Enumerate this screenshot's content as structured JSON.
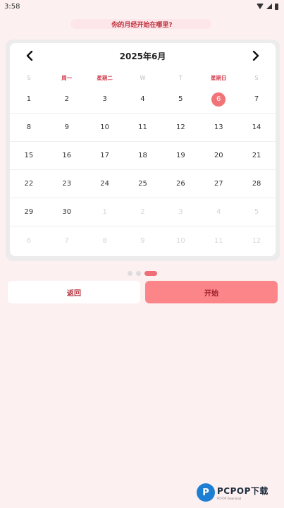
{
  "status_bar": {
    "time": "3:58"
  },
  "question": "你的月经开始在哪里?",
  "calendar": {
    "title": "2025年6月",
    "weekdays": [
      "S",
      "周一",
      "星期二",
      "W",
      "T",
      "星期日",
      "S"
    ],
    "weeks": [
      [
        {
          "d": "1"
        },
        {
          "d": "2"
        },
        {
          "d": "3"
        },
        {
          "d": "4"
        },
        {
          "d": "5"
        },
        {
          "d": "6",
          "selected": true
        },
        {
          "d": "7"
        }
      ],
      [
        {
          "d": "8"
        },
        {
          "d": "9"
        },
        {
          "d": "10"
        },
        {
          "d": "11"
        },
        {
          "d": "12"
        },
        {
          "d": "13"
        },
        {
          "d": "14"
        }
      ],
      [
        {
          "d": "15"
        },
        {
          "d": "16"
        },
        {
          "d": "17"
        },
        {
          "d": "18"
        },
        {
          "d": "19"
        },
        {
          "d": "20"
        },
        {
          "d": "21"
        }
      ],
      [
        {
          "d": "22"
        },
        {
          "d": "23"
        },
        {
          "d": "24"
        },
        {
          "d": "25"
        },
        {
          "d": "26"
        },
        {
          "d": "27"
        },
        {
          "d": "28"
        }
      ],
      [
        {
          "d": "29"
        },
        {
          "d": "30"
        },
        {
          "d": "1",
          "muted": true
        },
        {
          "d": "2",
          "muted": true
        },
        {
          "d": "3",
          "muted": true
        },
        {
          "d": "4",
          "muted": true
        },
        {
          "d": "5",
          "muted": true
        }
      ],
      [
        {
          "d": "6",
          "muted": true
        },
        {
          "d": "7",
          "muted": true
        },
        {
          "d": "8",
          "muted": true
        },
        {
          "d": "9",
          "muted": true
        },
        {
          "d": "10",
          "muted": true
        },
        {
          "d": "11",
          "muted": true
        },
        {
          "d": "12",
          "muted": true
        }
      ]
    ],
    "prev_icon": "chevron-left-icon",
    "next_icon": "chevron-right-icon"
  },
  "pager": {
    "total": 3,
    "active_index": 2
  },
  "buttons": {
    "back": "返回",
    "start": "开始"
  },
  "watermark": {
    "logo_letter": "P",
    "brand": "PCPOP下载",
    "tagline": "PCPOP Download"
  },
  "colors": {
    "accent": "#ef6f76",
    "background": "#fdf0f1",
    "text_red": "#c0313d"
  }
}
